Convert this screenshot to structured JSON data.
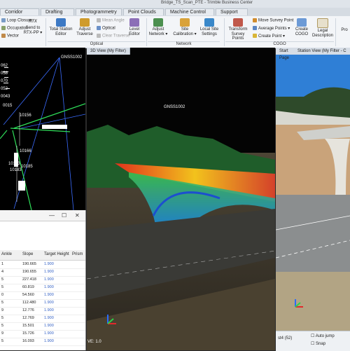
{
  "window": {
    "title": "Bridge_TS_Scan_PTE - Trimble Business Center"
  },
  "tabs": [
    "Corridor",
    "Drafting",
    "Photogrammetry",
    "Point Clouds",
    "Machine Control",
    "Support"
  ],
  "ribbon": {
    "survey_small": [
      "Loop Closure",
      "Occupation",
      "Vector"
    ],
    "rtx_label": "RTX",
    "send_to": "Send to RTX-PP ▾",
    "total_station_editor": "Total Station Editor",
    "adjust_traverse": "Adjust Traverse",
    "optical_small": [
      "Mean Angle",
      "Optical",
      "Clear Traverse"
    ],
    "level_editor": "Level Editor",
    "optical_group": "Optical",
    "adjust_network": "Adjust Network ▾",
    "site_calibration": "Site Calibration ▾",
    "local_site_settings": "Local Site Settings",
    "network_group": "Network",
    "transform_survey_points": "Transform Survey Points",
    "cogo_small": [
      "Move Survey Point",
      "Average Points ▾",
      "Create Point ▾"
    ],
    "create_cogo": "Create COGO",
    "legal_description": "Legal Description",
    "cogo_group": "COGO",
    "cut_label": "Pro"
  },
  "left_view": {
    "labels": [
      "GNSS1002",
      "0015",
      "10156",
      "10166",
      "10185",
      "10173",
      "10183"
    ],
    "column_values": [
      "062",
      "058",
      "070",
      "052",
      "0043"
    ]
  },
  "dialog": {
    "controls": [
      "—",
      "☐",
      "✕"
    ],
    "columns": [
      "Ankle",
      "Slope",
      "Target Height",
      "Prism"
    ],
    "rows": [
      {
        "a": "1",
        "slope": "190.665",
        "th": "1.900"
      },
      {
        "a": "4",
        "slope": "190.655",
        "th": "1.900"
      },
      {
        "a": "5",
        "slope": "227.418",
        "th": "1.900"
      },
      {
        "a": "5",
        "slope": "60.819",
        "th": "1.900"
      },
      {
        "a": "0",
        "slope": "54.560",
        "th": "1.900"
      },
      {
        "a": "5",
        "slope": "112.480",
        "th": "1.900"
      },
      {
        "a": "9",
        "slope": "12.776",
        "th": "1.900"
      },
      {
        "a": "5",
        "slope": "12.769",
        "th": "1.900"
      },
      {
        "a": "5",
        "slope": "15.501",
        "th": "1.900"
      },
      {
        "a": "9",
        "slope": "15.726",
        "th": "1.900"
      },
      {
        "a": "5",
        "slope": "16.093",
        "th": "1.900"
      }
    ]
  },
  "view3d": {
    "tab": "3D View (My Filter)",
    "point_label": "GNSS1002",
    "scale": "VE: 1.0"
  },
  "photo": {
    "tabs": [
      "Start Page",
      "Station View (My Filter - C"
    ],
    "status_id": "st4 (52)",
    "autojump": "Auto jump",
    "snap": "Snap"
  },
  "colors": {
    "ribbon_bg": "#f3f5f8",
    "accent": "#2f6db5",
    "cloud_hot": "#e0311c",
    "cloud_cool": "#1e9c6e"
  }
}
